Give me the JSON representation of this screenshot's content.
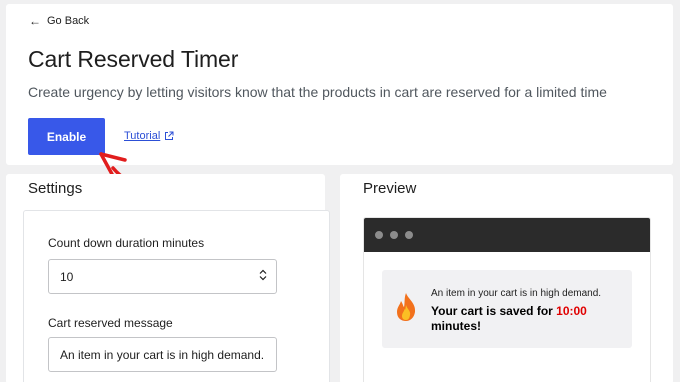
{
  "header": {
    "go_back_label": "Go Back",
    "title": "Cart Reserved Timer",
    "description": "Create urgency by letting visitors know that the products in cart are reserved for a limited time",
    "enable_label": "Enable",
    "tutorial_label": "Tutorial"
  },
  "settings": {
    "title": "Settings",
    "duration_label": "Count down duration minutes",
    "duration_value": "10",
    "message_label": "Cart reserved message",
    "message_value": "An item in your cart is in high demand."
  },
  "preview": {
    "title": "Preview",
    "notice_message": "An item in your cart is in high demand.",
    "notice_prefix": "Your cart is saved for ",
    "notice_time": "10:00",
    "notice_suffix": "minutes!"
  },
  "colors": {
    "accent": "#3858e9",
    "timer_red": "#e00000",
    "annotation_red": "#e11d1d",
    "browser_bar": "#2b2b2b"
  },
  "icons": {
    "back": "arrow-left-icon",
    "external": "external-link-icon",
    "stepper": "chevron-up-down-icon",
    "fire": "fire-icon"
  }
}
